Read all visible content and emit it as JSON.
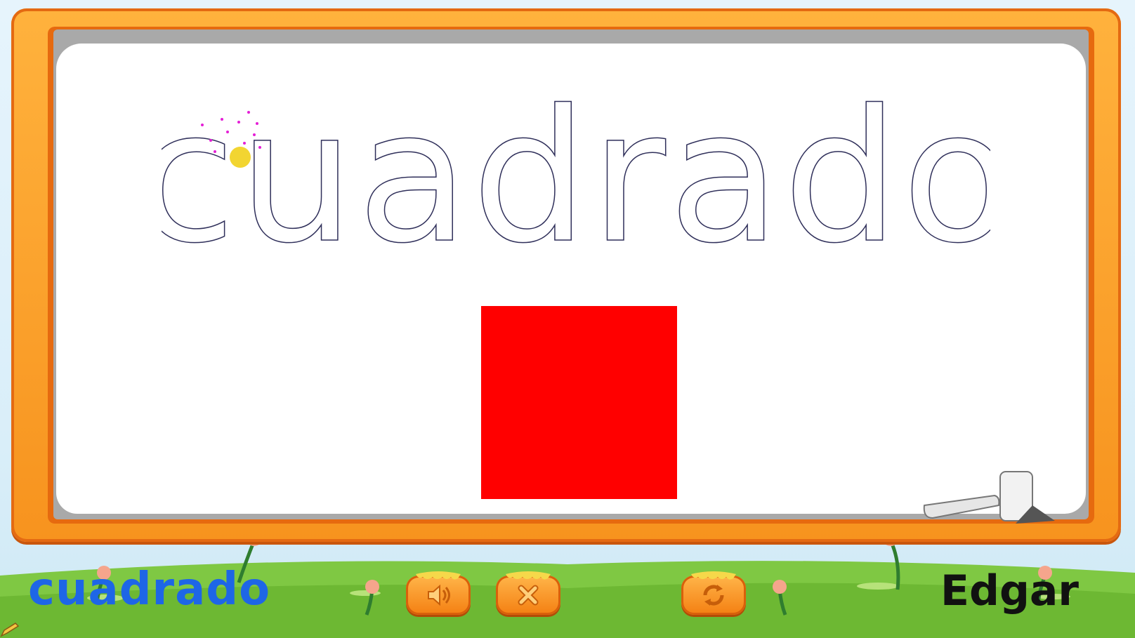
{
  "game": {
    "word": "cuadrado",
    "player_name": "Edgar",
    "shape": "square",
    "colors": {
      "frame": "#f7931e",
      "shape": "#ff0000",
      "word_color": "#1e66e6",
      "trace_outline": "#2f2f5a",
      "tracer_dot": "#f2d531",
      "sparkle": "#e51fd6"
    }
  },
  "controls": {
    "sound_icon": "speaker-icon",
    "close_icon": "close-x-icon",
    "replay_icon": "replay-icon"
  }
}
